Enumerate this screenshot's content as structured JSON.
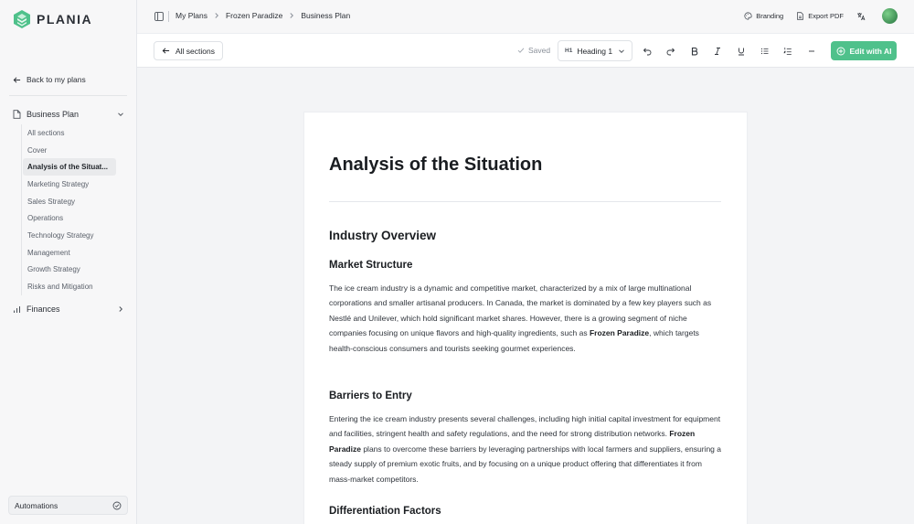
{
  "brand": {
    "name": "PLANIA",
    "color": "#4fc18b"
  },
  "sidebar": {
    "back_label": "Back to my plans",
    "plan_group": {
      "label": "Business Plan",
      "icon": "document-icon"
    },
    "sections": [
      {
        "label": "All sections"
      },
      {
        "label": "Cover"
      },
      {
        "label": "Analysis of the Situat...",
        "active": true
      },
      {
        "label": "Marketing Strategy"
      },
      {
        "label": "Sales Strategy"
      },
      {
        "label": "Operations"
      },
      {
        "label": "Technology Strategy"
      },
      {
        "label": "Management"
      },
      {
        "label": "Growth Strategy"
      },
      {
        "label": "Risks and Mitigation"
      }
    ],
    "finances_label": "Finances",
    "automations_label": "Automations"
  },
  "topbar": {
    "breadcrumb": [
      "My Plans",
      "Frozen Paradize",
      "Business Plan"
    ],
    "branding_label": "Branding",
    "export_label": "Export PDF"
  },
  "toolbar": {
    "all_sections_label": "All sections",
    "saved_label": "Saved",
    "heading_prefix": "H1",
    "heading_value": "Heading 1",
    "edit_ai_label": "Edit with AI"
  },
  "document": {
    "title": "Analysis of the Situation",
    "h2_industry": "Industry Overview",
    "h3_market": "Market Structure",
    "p_market": {
      "a": "The ice cream industry is a dynamic and competitive market, characterized by a mix of large multinational corporations and smaller artisanal producers. In Canada, the market is dominated by a few key players such as Nestlé and Unilever, which hold significant market shares. However, there is a growing segment of niche companies focusing on unique flavors and high-quality ingredients, such as ",
      "bold": "Frozen Paradize",
      "b": ", which targets health-conscious consumers and tourists seeking gourmet experiences."
    },
    "h3_barriers": "Barriers to Entry",
    "p_barriers": {
      "a": "Entering the ice cream industry presents several challenges, including high initial capital investment for equipment and facilities, stringent health and safety regulations, and the need for strong distribution networks. ",
      "bold": "Frozen Paradize",
      "b": " plans to overcome these barriers by leveraging partnerships with local farmers and suppliers, ensuring a steady supply of premium exotic fruits, and by focusing on a unique product offering that differentiates it from mass-market competitors."
    },
    "h3_diff": "Differentiation Factors"
  }
}
